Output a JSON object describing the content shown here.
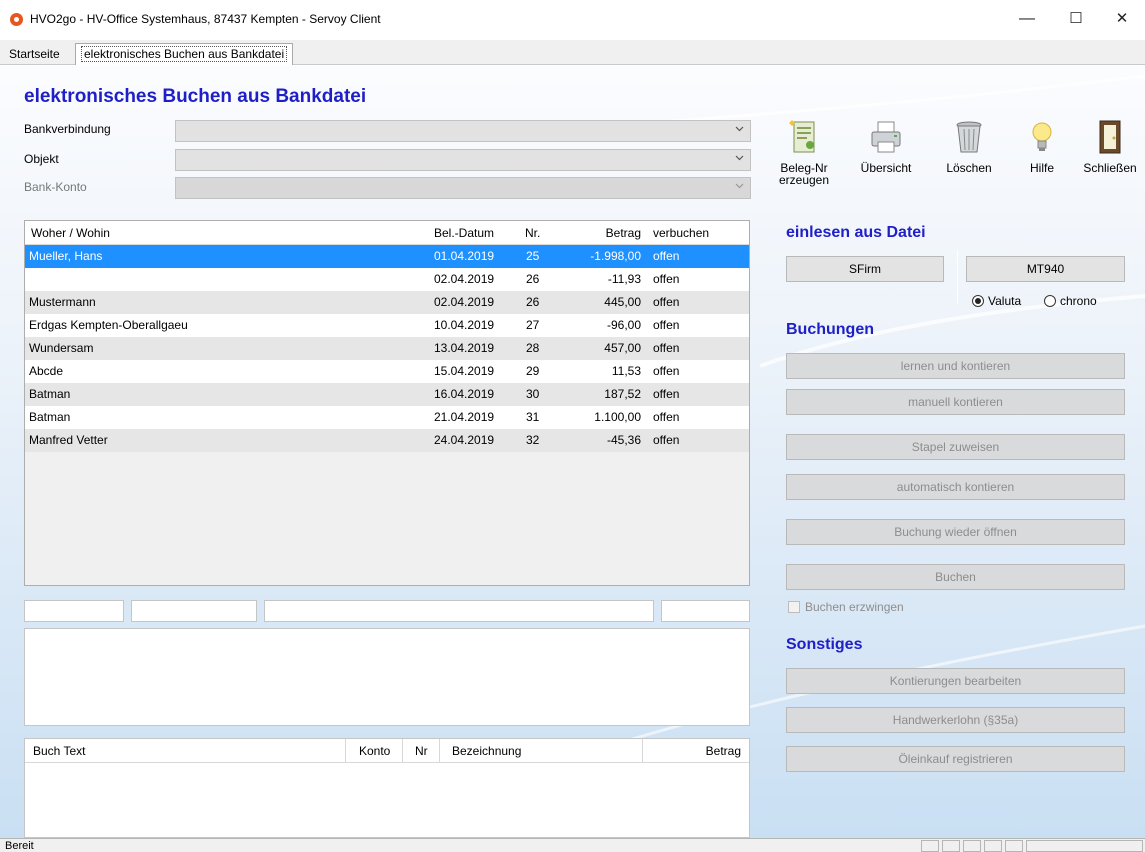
{
  "window": {
    "title": "HVO2go - HV-Office Systemhaus, 87437 Kempten  - Servoy Client",
    "minimize_label": "—",
    "maximize_label": "☐",
    "close_label": "✕"
  },
  "tabs": [
    {
      "label": "Startseite"
    },
    {
      "label": "elektronisches Buchen aus Bankdatei"
    }
  ],
  "page_title": "elektronisches Buchen aus Bankdatei",
  "form": {
    "bankverbindung_label": "Bankverbindung",
    "objekt_label": "Objekt",
    "bank_konto_label": "Bank-Konto"
  },
  "table": {
    "headers": [
      "Woher / Wohin",
      "Bel.-Datum",
      "Nr.",
      "Betrag",
      "verbuchen"
    ],
    "rows": [
      {
        "name": "Mueller, Hans",
        "date": "01.04.2019",
        "nr": "25",
        "betrag": "-1.998,00",
        "status": "offen"
      },
      {
        "name": "",
        "date": "02.04.2019",
        "nr": "26",
        "betrag": "-11,93",
        "status": "offen"
      },
      {
        "name": "Mustermann",
        "date": "02.04.2019",
        "nr": "26",
        "betrag": "445,00",
        "status": "offen"
      },
      {
        "name": "Erdgas Kempten-Oberallgaeu",
        "date": "10.04.2019",
        "nr": "27",
        "betrag": "-96,00",
        "status": "offen"
      },
      {
        "name": "Wundersam",
        "date": "13.04.2019",
        "nr": "28",
        "betrag": "457,00",
        "status": "offen"
      },
      {
        "name": "Abcde",
        "date": "15.04.2019",
        "nr": "29",
        "betrag": "11,53",
        "status": "offen"
      },
      {
        "name": "Batman",
        "date": "16.04.2019",
        "nr": "30",
        "betrag": "187,52",
        "status": "offen"
      },
      {
        "name": "Batman",
        "date": "21.04.2019",
        "nr": "31",
        "betrag": "1.100,00",
        "status": "offen"
      },
      {
        "name": "Manfred Vetter",
        "date": "24.04.2019",
        "nr": "32",
        "betrag": "-45,36",
        "status": "offen"
      }
    ]
  },
  "booking_table": {
    "headers": [
      "Buch Text",
      "Konto",
      "Nr",
      "Bezeichnung",
      "Betrag"
    ]
  },
  "toolbar": [
    {
      "label": "Beleg-Nr",
      "label2": "erzeugen",
      "icon": "document-icon"
    },
    {
      "label": "Übersicht",
      "label2": "",
      "icon": "printer-icon"
    },
    {
      "label": "Löschen",
      "label2": "",
      "icon": "trash-icon"
    },
    {
      "label": "Hilfe",
      "label2": "",
      "icon": "lightbulb-icon"
    },
    {
      "label": "Schließen",
      "label2": "",
      "icon": "door-icon"
    }
  ],
  "import": {
    "heading": "einlesen aus Datei",
    "sfirm_label": "SFirm",
    "mt940_label": "MT940",
    "radio_valuta": "Valuta",
    "radio_chrono": "chrono",
    "selected": "Valuta"
  },
  "buchungen": {
    "heading": "Buchungen",
    "buttons": [
      "lernen und kontieren",
      "manuell kontieren",
      "Stapel zuweisen",
      "automatisch kontieren",
      "Buchung wieder öffnen",
      "Buchen"
    ],
    "force_label": "Buchen erzwingen"
  },
  "sonstiges": {
    "heading": "Sonstiges",
    "buttons": [
      "Kontierungen bearbeiten",
      "Handwerkerlohn (§35a)",
      "Öleinkauf registrieren"
    ]
  },
  "status": {
    "text": "Bereit"
  },
  "colors": {
    "heading_blue": "#1f1fc8",
    "selection_blue": "#1e90ff",
    "app_icon_orange": "#e8561f"
  }
}
